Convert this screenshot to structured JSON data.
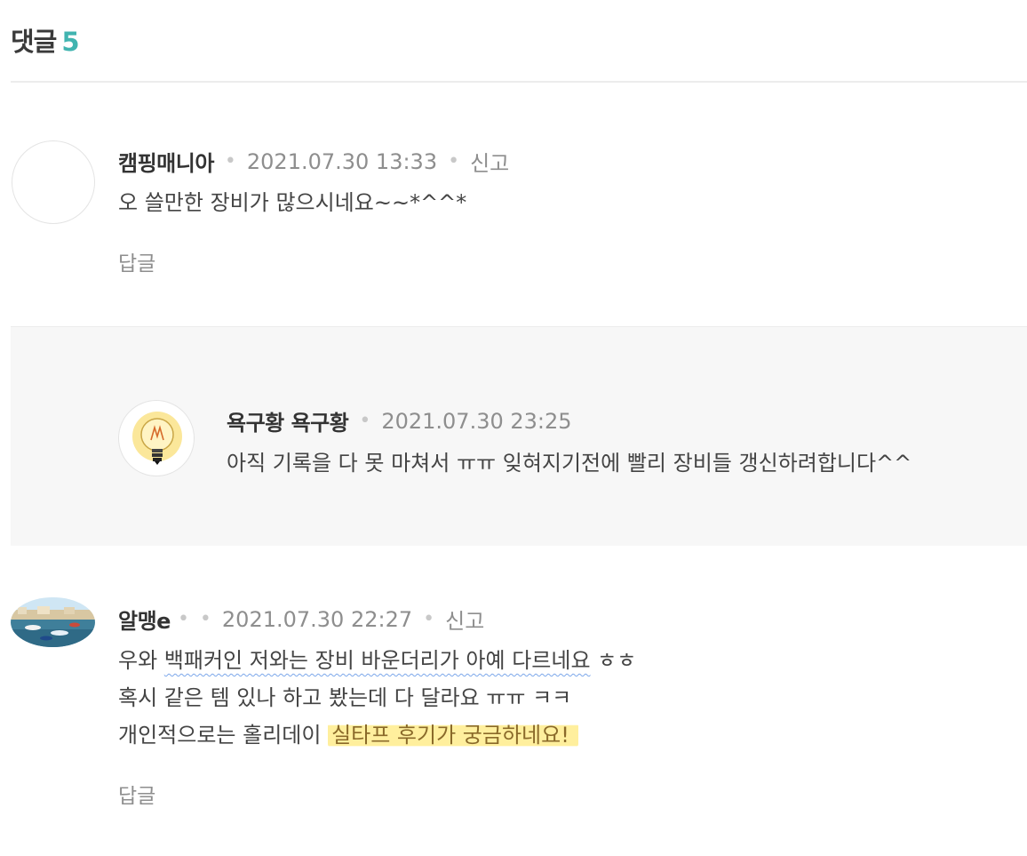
{
  "header": {
    "label": "댓글",
    "count": "5"
  },
  "comments": [
    {
      "nickname": "캠핑매니아",
      "date": "2021.07.30 13:33",
      "report": "신고",
      "text": "오 쓸만한 장비가 많으시네요~~*^^*",
      "reply_label": "답글"
    },
    {
      "nickname": "욕구황 욕구황",
      "date": "2021.07.30 23:25",
      "text": "아직 기록을 다 못 마쳐서 ㅠㅠ 잊혀지기전에 빨리 장비들 갱신하려합니다^^"
    },
    {
      "nickname": "알맹e",
      "date": "2021.07.30 22:27",
      "report": "신고",
      "line1_a": "우와 ",
      "line1_b": "백패커인 저와는 장비 바운더리가 아예 다르네요",
      "line1_c": " ㅎㅎ",
      "line2": "혹시 같은 템 있나 하고 봤는데 다 달라요 ㅠㅠ ㅋㅋ",
      "line3_a": "개인적으로는 홀리데이 ",
      "line3_b": "실타프 후기가 궁금하네요!",
      "reply_label": "답글"
    }
  ],
  "colors": {
    "accent": "#41b4b0",
    "highlight": "#fff0a0"
  }
}
